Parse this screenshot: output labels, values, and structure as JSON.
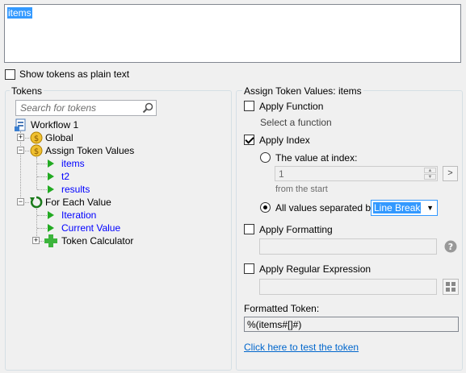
{
  "editor": {
    "text": "items"
  },
  "show_plain": {
    "label": "Show tokens as plain text",
    "checked": false
  },
  "tokens_panel": {
    "title": "Tokens",
    "search_placeholder": "Search for tokens",
    "tree": {
      "root": "Workflow 1",
      "global": "Global",
      "assign": "Assign Token Values",
      "assign_children": [
        "items",
        "t2",
        "results"
      ],
      "foreach": "For Each Value",
      "foreach_children": [
        "Iteration",
        "Current Value"
      ],
      "calc": "Token Calculator"
    }
  },
  "assign_panel": {
    "title": "Assign Token Values: items",
    "apply_function": {
      "label": "Apply Function",
      "checked": false,
      "hint": "Select a function"
    },
    "apply_index": {
      "label": "Apply Index",
      "checked": true,
      "value_at_index_label": "The value at index:",
      "index_value": "1",
      "from_label": "from the  start",
      "all_values_label": "All values separated by:",
      "separator_selected": "Line Break"
    },
    "apply_formatting": {
      "label": "Apply Formatting",
      "checked": false
    },
    "apply_regex": {
      "label": "Apply Regular Expression",
      "checked": false
    },
    "formatted_label": "Formatted Token:",
    "formatted_value": "%(items#[]#)",
    "test_link": "Click here to test the token"
  }
}
